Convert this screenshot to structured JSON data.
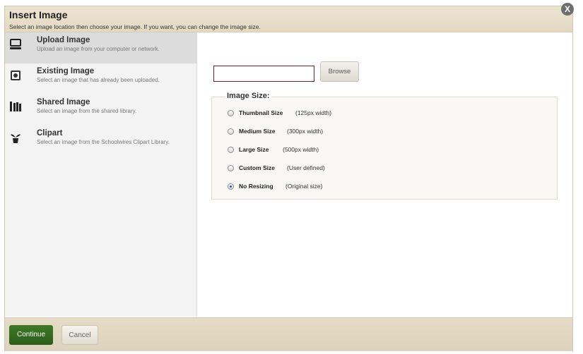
{
  "dialog": {
    "title": "Insert Image",
    "subtitle": "Select an image location then choose your image. If you want, you can change the image size.",
    "close_label": "X"
  },
  "sidebar": {
    "items": [
      {
        "label": "Upload Image",
        "desc": "Upload an image from your computer or network.",
        "icon": "computer-icon",
        "active": true
      },
      {
        "label": "Existing Image",
        "desc": "Select an image that has already been uploaded.",
        "icon": "image-icon",
        "active": false
      },
      {
        "label": "Shared Image",
        "desc": "Select an image from the shared library.",
        "icon": "library-icon",
        "active": false
      },
      {
        "label": "Clipart",
        "desc": "Select an image from the Schoolwires Clipart Library.",
        "icon": "clipart-icon",
        "active": false
      }
    ]
  },
  "upload": {
    "file_value": "",
    "browse_label": "Browse"
  },
  "image_size": {
    "legend": "Image Size:",
    "options": [
      {
        "label": "Thumbnail Size",
        "note": "(125px width)",
        "selected": false
      },
      {
        "label": "Medium Size",
        "note": "(300px width)",
        "selected": false
      },
      {
        "label": "Large Size",
        "note": "(500px width)",
        "selected": false
      },
      {
        "label": "Custom Size",
        "note": "(User defined)",
        "selected": false
      },
      {
        "label": "No Resizing",
        "note": "(Original size)",
        "selected": true
      }
    ]
  },
  "footer": {
    "continue_label": "Continue",
    "cancel_label": "Cancel"
  },
  "colors": {
    "header_bg": "#e6ddc8",
    "primary_button": "#356d22",
    "input_border": "#7a1f1f"
  }
}
